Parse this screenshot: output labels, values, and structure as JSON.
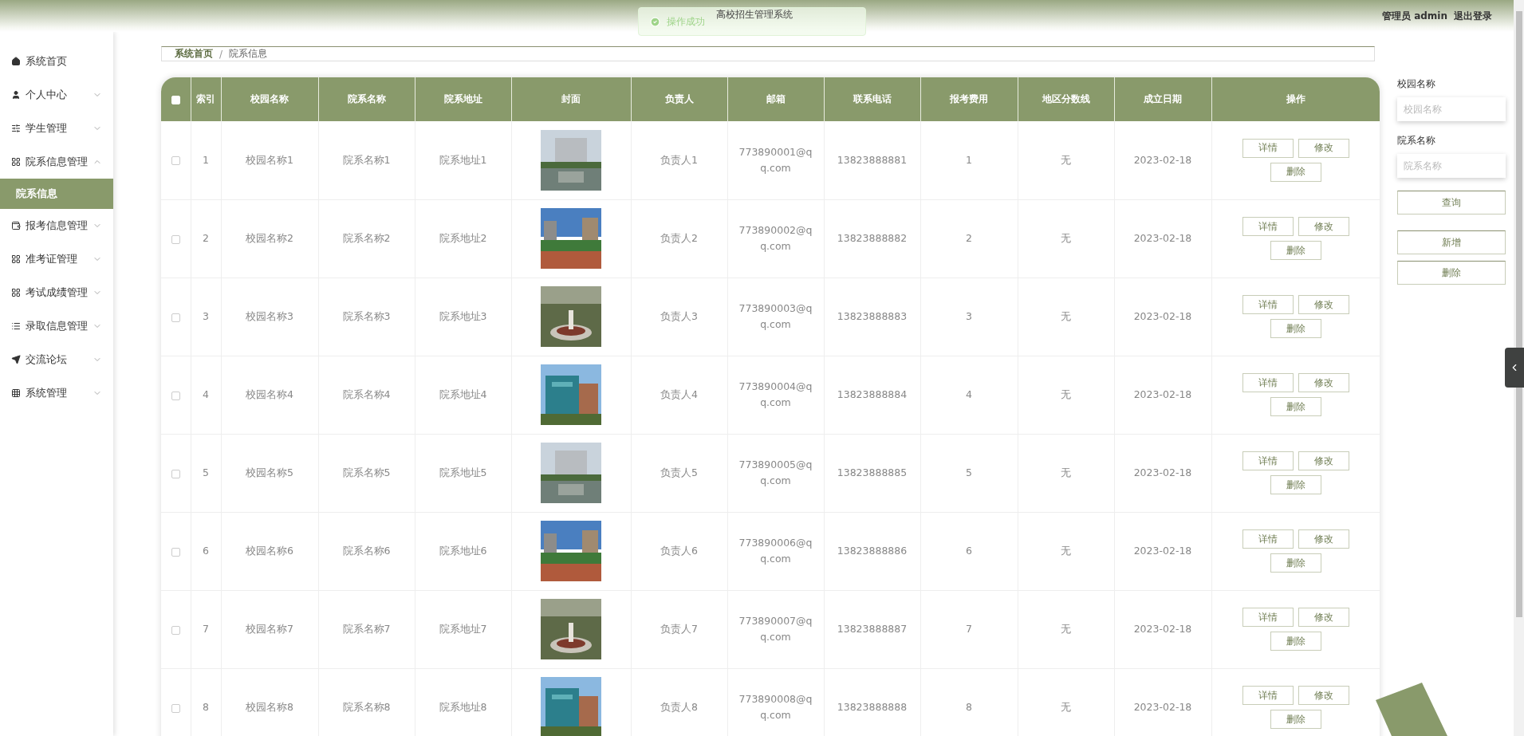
{
  "header": {
    "title": "高校招生管理系统",
    "user": "管理员 admin",
    "logout": "退出登录",
    "toast": {
      "text": "操作成功"
    }
  },
  "sidebar": {
    "items": [
      {
        "label": "系统首页",
        "has_arrow": false
      },
      {
        "label": "个人中心",
        "expanded": false,
        "has_arrow": true
      },
      {
        "label": "学生管理",
        "expanded": false,
        "has_arrow": true
      },
      {
        "label": "院系信息管理",
        "expanded": true,
        "has_arrow": true,
        "children": [
          {
            "label": "院系信息",
            "selected": true
          }
        ]
      },
      {
        "label": "报考信息管理",
        "expanded": false,
        "has_arrow": true
      },
      {
        "label": "准考证管理",
        "expanded": false,
        "has_arrow": true
      },
      {
        "label": "考试成绩管理",
        "expanded": false,
        "has_arrow": true
      },
      {
        "label": "录取信息管理",
        "expanded": false,
        "has_arrow": true
      },
      {
        "label": "交流论坛",
        "expanded": false,
        "has_arrow": true
      },
      {
        "label": "系统管理",
        "expanded": false,
        "has_arrow": true
      }
    ]
  },
  "breadcrumb": {
    "separator": "/",
    "items": [
      {
        "label": "系统首页"
      },
      {
        "label": "院系信息"
      }
    ]
  },
  "table": {
    "select_all": {
      "checked": false
    },
    "columns": [
      "索引",
      "校园名称",
      "院系名称",
      "院系地址",
      "封面",
      "负责人",
      "邮箱",
      "联系电话",
      "报考费用",
      "地区分数线",
      "成立日期",
      "操作"
    ],
    "rows": [
      {
        "checked": false,
        "cells": [
          "1",
          "校园名称1",
          "院系名称1",
          "院系地址1",
          null,
          "负责人1",
          "773890001@qq.com",
          "13823888881",
          "1",
          "无",
          "2023-02-18"
        ],
        "actions": [
          "详情",
          "修改",
          "删除"
        ]
      },
      {
        "checked": false,
        "cells": [
          "2",
          "校园名称2",
          "院系名称2",
          "院系地址2",
          null,
          "负责人2",
          "773890002@qq.com",
          "13823888882",
          "2",
          "无",
          "2023-02-18"
        ],
        "actions": [
          "详情",
          "修改",
          "删除"
        ]
      },
      {
        "checked": false,
        "cells": [
          "3",
          "校园名称3",
          "院系名称3",
          "院系地址3",
          null,
          "负责人3",
          "773890003@qq.com",
          "13823888883",
          "3",
          "无",
          "2023-02-18"
        ],
        "actions": [
          "详情",
          "修改",
          "删除"
        ]
      },
      {
        "checked": false,
        "cells": [
          "4",
          "校园名称4",
          "院系名称4",
          "院系地址4",
          null,
          "负责人4",
          "773890004@qq.com",
          "13823888884",
          "4",
          "无",
          "2023-02-18"
        ],
        "actions": [
          "详情",
          "修改",
          "删除"
        ]
      },
      {
        "checked": false,
        "cells": [
          "5",
          "校园名称5",
          "院系名称5",
          "院系地址5",
          null,
          "负责人5",
          "773890005@qq.com",
          "13823888885",
          "5",
          "无",
          "2023-02-18"
        ],
        "actions": [
          "详情",
          "修改",
          "删除"
        ]
      },
      {
        "checked": false,
        "cells": [
          "6",
          "校园名称6",
          "院系名称6",
          "院系地址6",
          null,
          "负责人6",
          "773890006@qq.com",
          "13823888886",
          "6",
          "无",
          "2023-02-18"
        ],
        "actions": [
          "详情",
          "修改",
          "删除"
        ]
      },
      {
        "checked": false,
        "cells": [
          "7",
          "校园名称7",
          "院系名称7",
          "院系地址7",
          null,
          "负责人7",
          "773890007@qq.com",
          "13823888887",
          "7",
          "无",
          "2023-02-18"
        ],
        "actions": [
          "详情",
          "修改",
          "删除"
        ]
      },
      {
        "checked": false,
        "cells": [
          "8",
          "校园名称8",
          "院系名称8",
          "院系地址8",
          null,
          "负责人8",
          "773890008@qq.com",
          "13823888888",
          "8",
          "无",
          "2023-02-18"
        ],
        "actions": [
          "详情",
          "修改",
          "删除"
        ]
      }
    ]
  },
  "search": {
    "fields": [
      {
        "label": "校园名称",
        "placeholder": "校园名称"
      },
      {
        "label": "院系名称",
        "placeholder": "院系名称"
      }
    ],
    "query_button": "查询",
    "buttons": [
      "新增",
      "删除"
    ]
  }
}
